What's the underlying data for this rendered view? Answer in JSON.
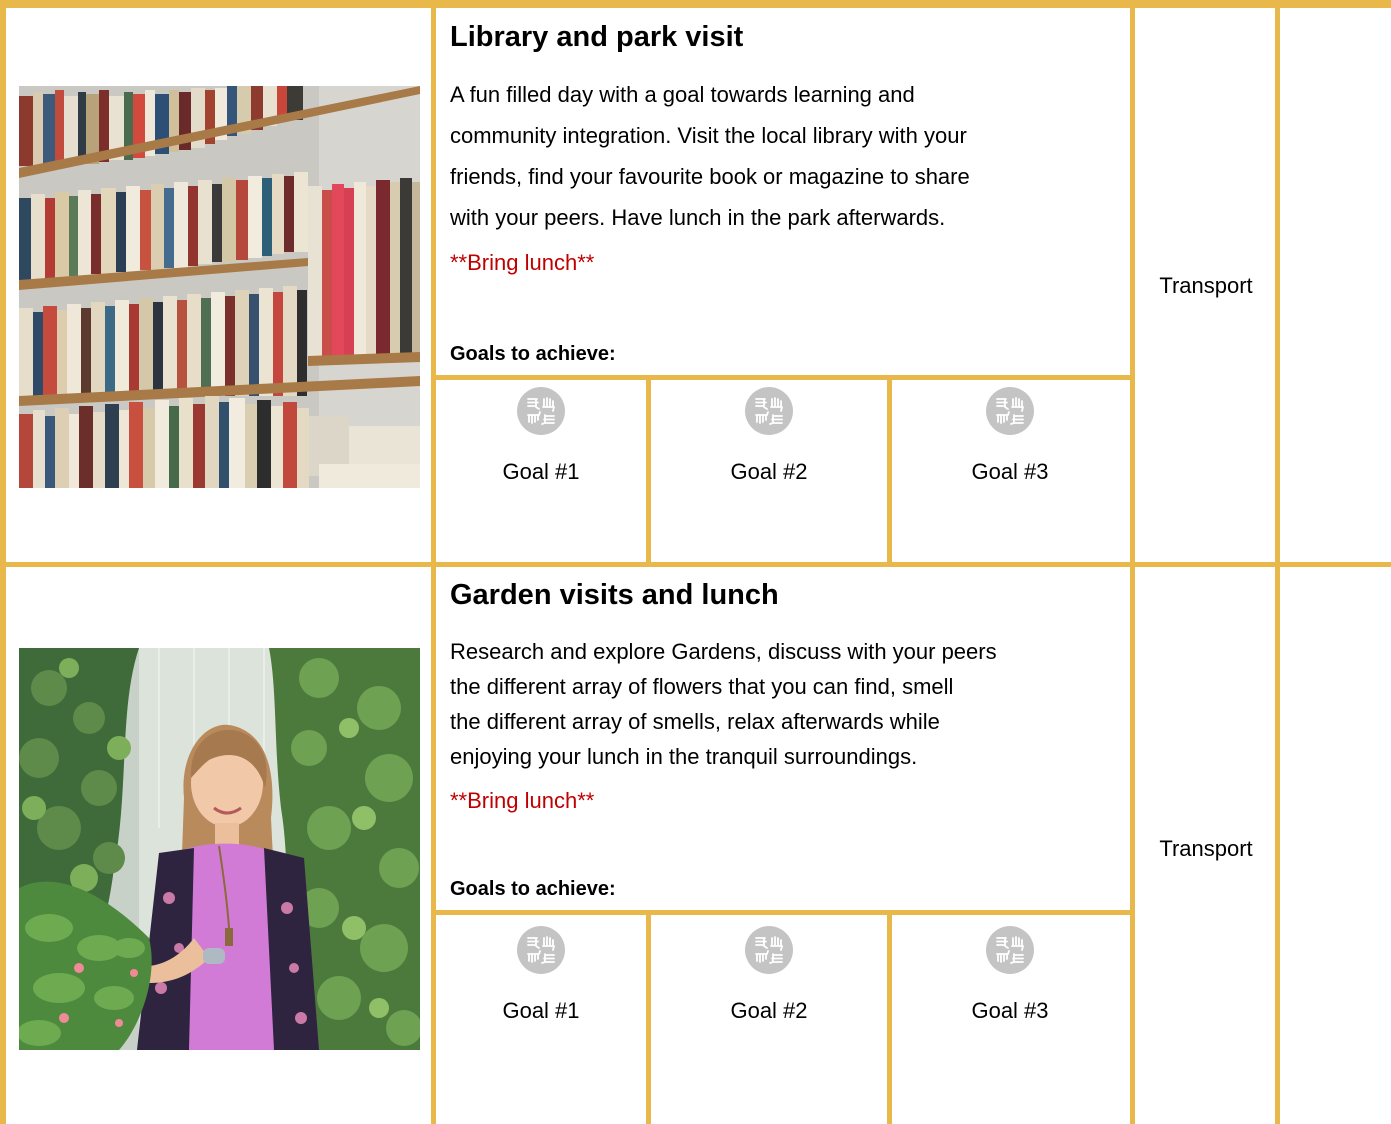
{
  "accent_color": "#E8B84B",
  "note_color": "#C00000",
  "activities": [
    {
      "image": "bookshelf-photo",
      "title": "Library and park visit",
      "description_lines": [
        "A fun filled day with a goal towards learning and",
        "community integration. Visit the local library with your",
        "friends, find your favourite book or magazine to share",
        "with your peers. Have lunch in the park afterwards."
      ],
      "note": "**Bring lunch**",
      "goals_heading": "Goals to achieve:",
      "goals": [
        {
          "icon": "teamwork-hands-icon",
          "label": "Goal #1"
        },
        {
          "icon": "teamwork-hands-icon",
          "label": "Goal #2"
        },
        {
          "icon": "teamwork-hands-icon",
          "label": "Goal #3"
        }
      ],
      "transport": "Transport"
    },
    {
      "image": "garden-woman-photo",
      "title": "Garden visits and lunch",
      "description_lines": [
        "Research and explore Gardens, discuss with your peers",
        "the different array of flowers that you can find, smell",
        "the different array of smells, relax afterwards while",
        "enjoying your lunch in the tranquil surroundings."
      ],
      "note": "**Bring lunch**",
      "goals_heading": "Goals to achieve:",
      "goals": [
        {
          "icon": "teamwork-hands-icon",
          "label": "Goal #1"
        },
        {
          "icon": "teamwork-hands-icon",
          "label": "Goal #2"
        },
        {
          "icon": "teamwork-hands-icon",
          "label": "Goal #3"
        }
      ],
      "transport": "Transport"
    }
  ]
}
